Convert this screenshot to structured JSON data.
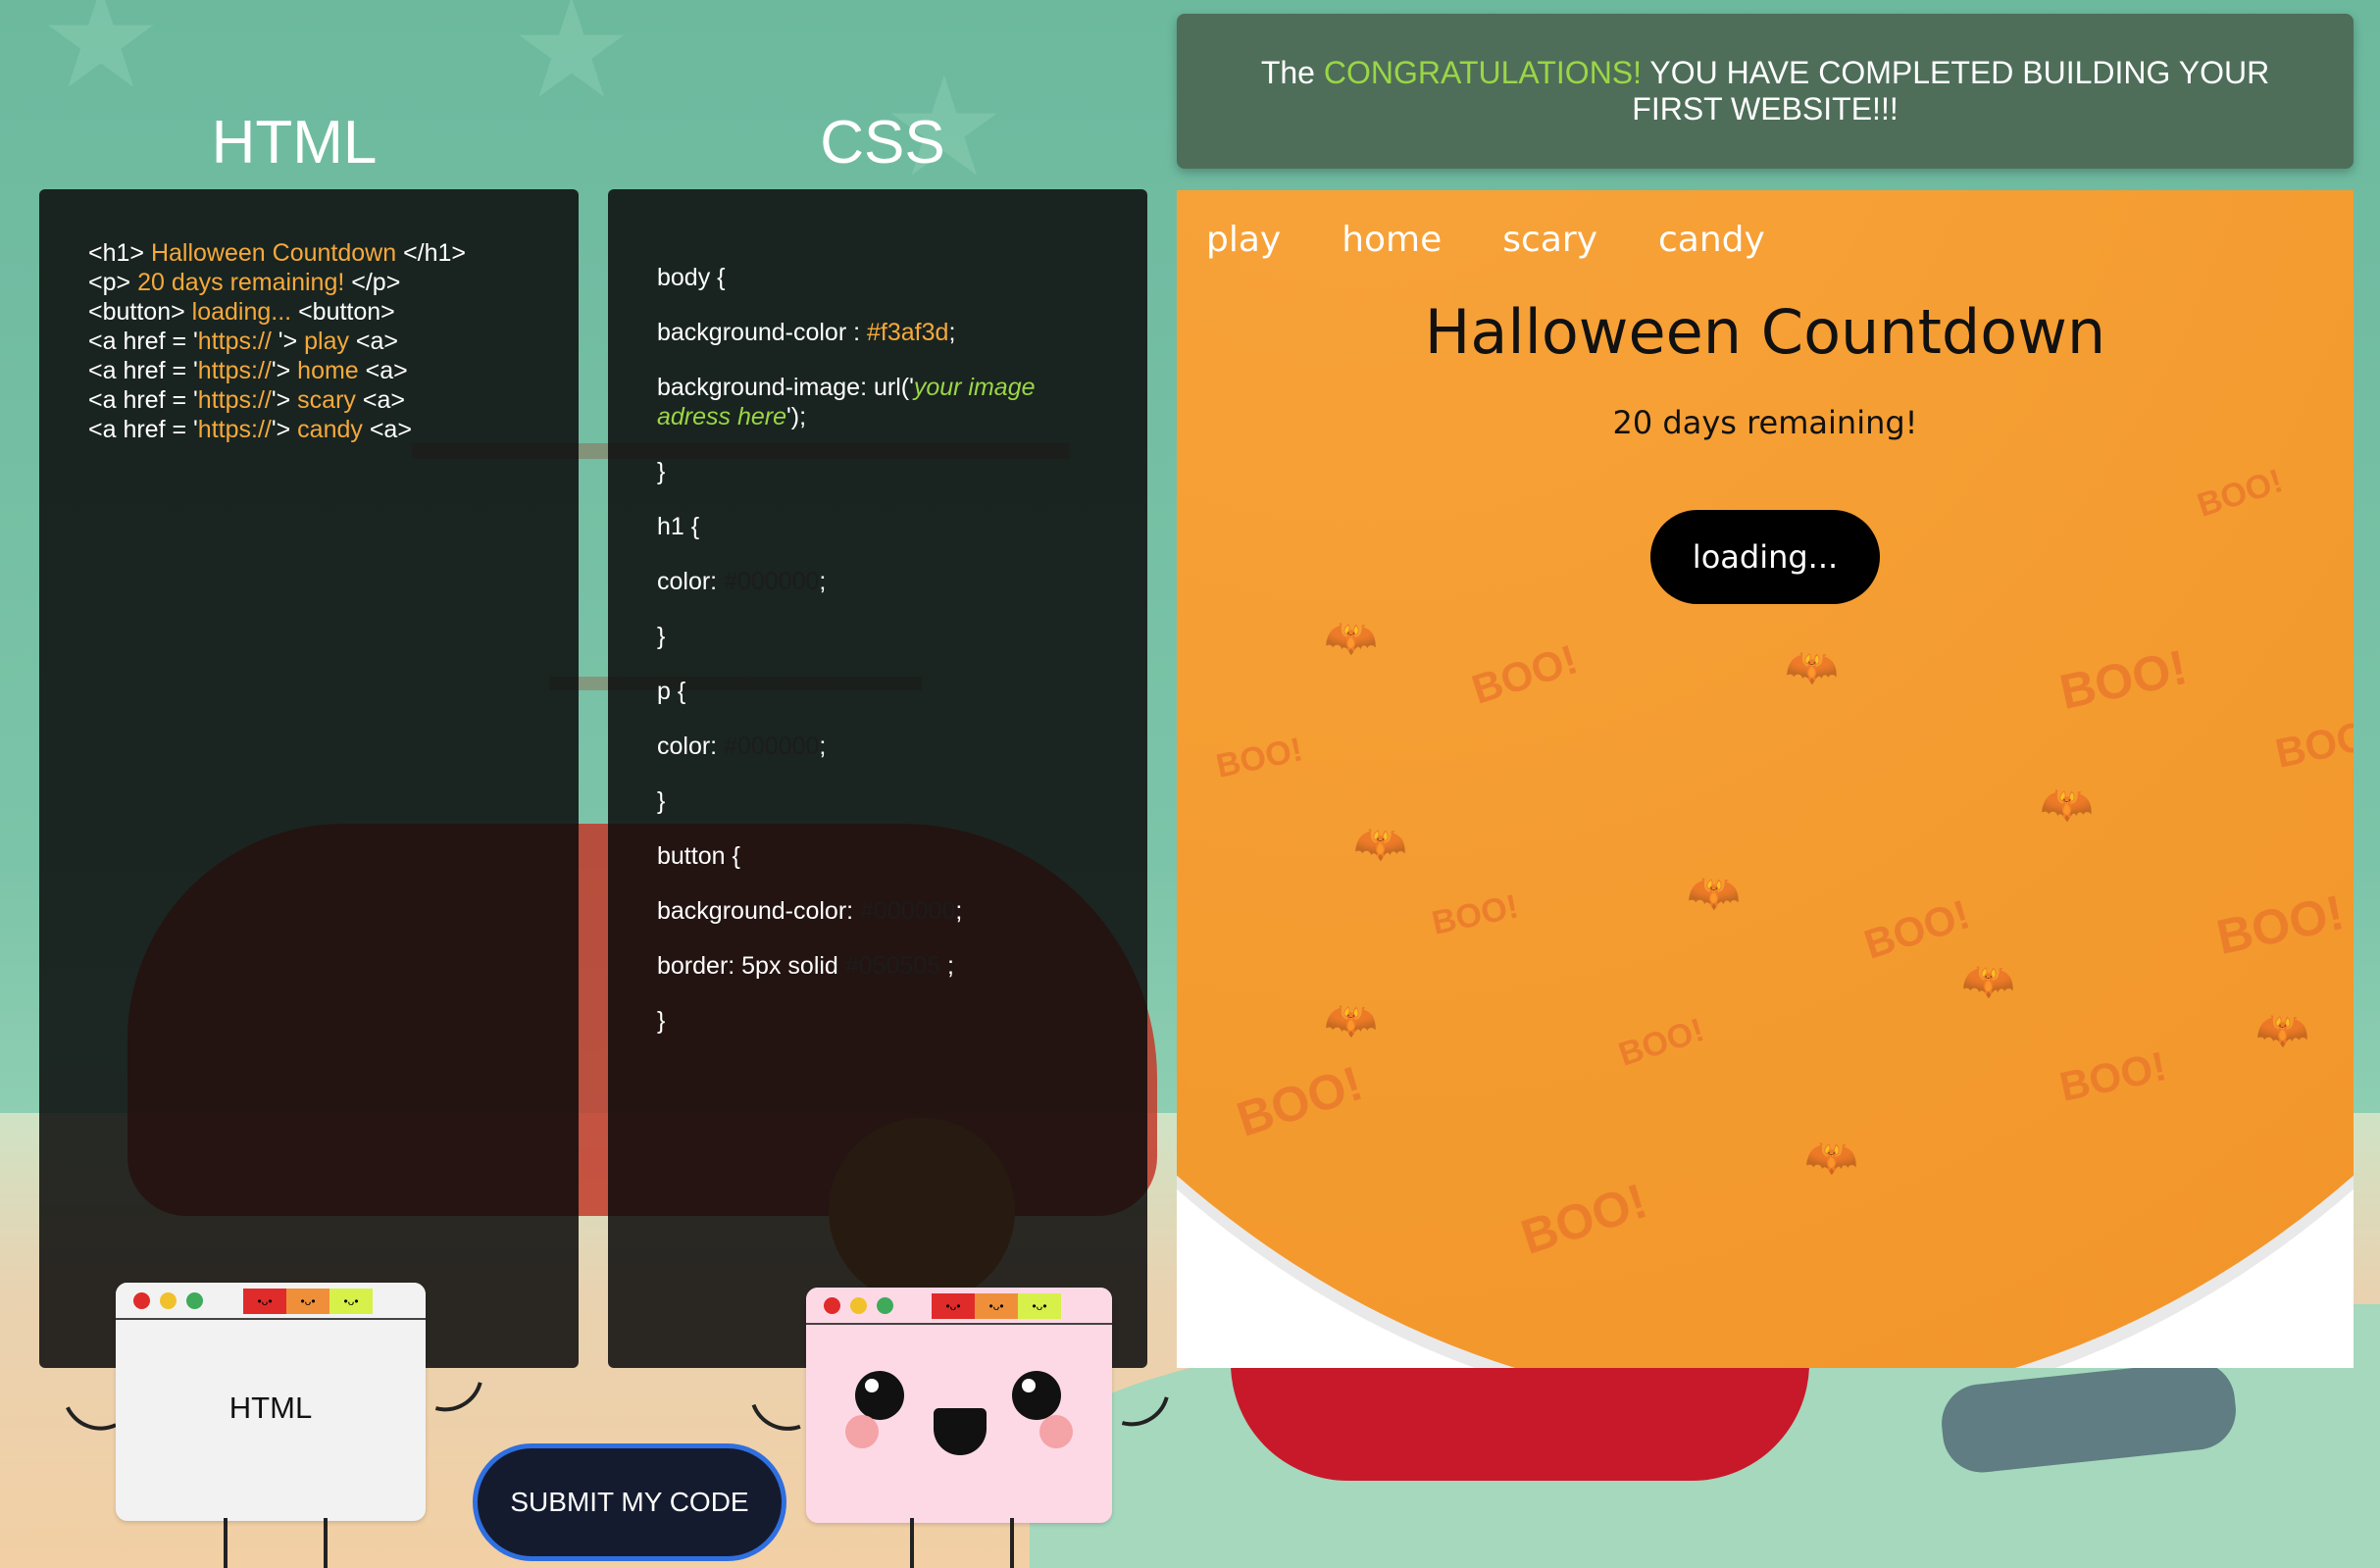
{
  "columns": {
    "html_title": "HTML",
    "css_title": "CSS"
  },
  "html_code": [
    [
      {
        "t": "<h1> "
      },
      {
        "t": "Halloween Countdown",
        "c": "hl"
      },
      {
        "t": " </h1>"
      }
    ],
    [
      {
        "t": "<p> "
      },
      {
        "t": "20 days remaining!",
        "c": "hl"
      },
      {
        "t": " </p>"
      }
    ],
    [
      {
        "t": "<button> "
      },
      {
        "t": "loading...",
        "c": "hl"
      },
      {
        "t": " <button>"
      }
    ],
    [
      {
        "t": "<a href = '"
      },
      {
        "t": "https://",
        "c": "hl"
      },
      {
        "t": " '> "
      },
      {
        "t": "play",
        "c": "hl"
      },
      {
        "t": " <a>"
      }
    ],
    [
      {
        "t": "<a href = '"
      },
      {
        "t": "https://",
        "c": "hl"
      },
      {
        "t": "'> "
      },
      {
        "t": "home",
        "c": "hl"
      },
      {
        "t": " <a>"
      }
    ],
    [
      {
        "t": "<a href = '"
      },
      {
        "t": "https://",
        "c": "hl"
      },
      {
        "t": "'> "
      },
      {
        "t": "scary",
        "c": "hl"
      },
      {
        "t": " <a>"
      }
    ],
    [
      {
        "t": "<a href = '"
      },
      {
        "t": "https://",
        "c": "hl"
      },
      {
        "t": "'> "
      },
      {
        "t": "candy",
        "c": "hl"
      },
      {
        "t": " <a>"
      }
    ]
  ],
  "css_code": [
    [
      {
        "t": "body {"
      }
    ],
    [
      {
        "t": "background-color : "
      },
      {
        "t": "#f3af3d",
        "c": "hl"
      },
      {
        "t": ";"
      }
    ],
    [
      {
        "t": "background-image: url('"
      },
      {
        "t": "your image adress here",
        "c": "it"
      },
      {
        "t": "');"
      }
    ],
    [
      {
        "t": "}"
      }
    ],
    [
      {
        "t": "h1 {"
      }
    ],
    [
      {
        "t": "color: "
      },
      {
        "t": "#000000",
        "c": "dark"
      },
      {
        "t": ";"
      }
    ],
    [
      {
        "t": "}"
      }
    ],
    [
      {
        "t": "p {"
      }
    ],
    [
      {
        "t": "color: "
      },
      {
        "t": "#000000",
        "c": "dark"
      },
      {
        "t": ";"
      }
    ],
    [
      {
        "t": "}"
      }
    ],
    [
      {
        "t": "button {"
      }
    ],
    [
      {
        "t": "background-color: "
      },
      {
        "t": "#000000",
        "c": "dark"
      },
      {
        "t": ";"
      }
    ],
    [
      {
        "t": "border: 5px solid "
      },
      {
        "t": "#050505",
        "c": "dark"
      },
      {
        "t": "   ;"
      }
    ],
    [
      {
        "t": "}"
      }
    ]
  ],
  "banner": {
    "prefix": "The ",
    "highlight": "CONGRATULATIONS!",
    "rest": " YOU HAVE COMPLETED BUILDING YOUR FIRST WEBSITE!!!"
  },
  "preview": {
    "nav": [
      "play",
      "home",
      "scary",
      "candy"
    ],
    "title": "Halloween Countdown",
    "subtitle": "20 days remaining!",
    "button": "loading...",
    "pattern_words": [
      "BOO!",
      "BOO!",
      "BOO!",
      "BOO!",
      "BOO!",
      "BOO!",
      "BOO!",
      "BOO!",
      "BOO!",
      "BOO!",
      "BOO!",
      "BOO!"
    ]
  },
  "characters": {
    "html_label": "HTML"
  },
  "submit_label": "SUBMIT MY CODE",
  "colors": {
    "accent_green": "#9bd645",
    "code_highlight": "#f6a93b",
    "preview_bg": "#f3af3d",
    "banner_bg": "#4e6e59"
  }
}
